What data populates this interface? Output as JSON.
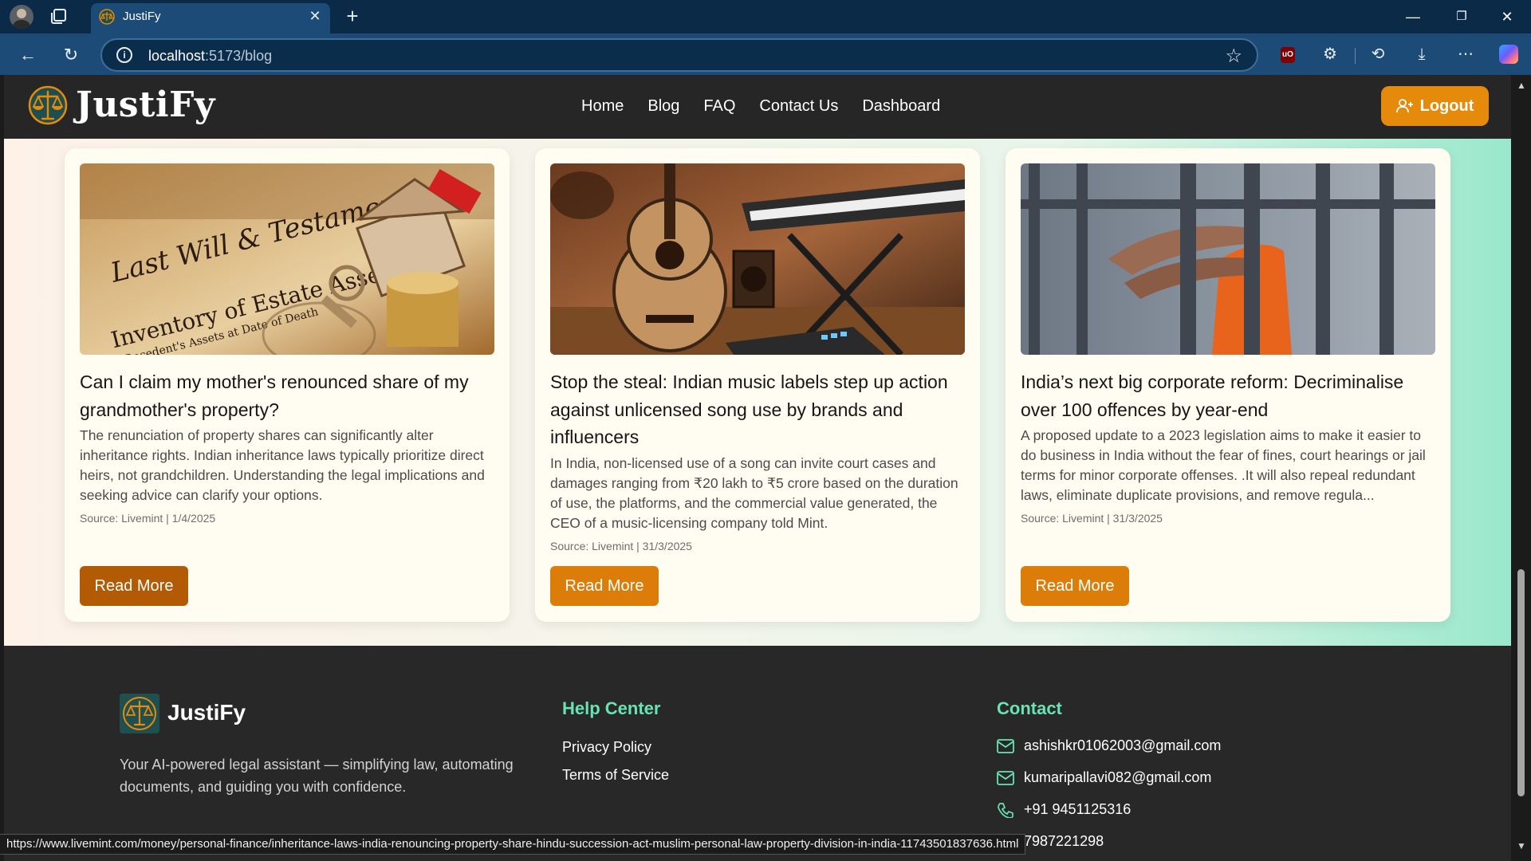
{
  "browser": {
    "tab_title": "JustiFy",
    "url_host": "localhost",
    "url_path": ":5173/blog",
    "status_url": "https://www.livemint.com/money/personal-finance/inheritance-laws-india-renouncing-property-share-hindu-succession-act-muslim-personal-law-property-division-in-india-11743501837636.html",
    "icons": [
      "profile-icon",
      "tabs-icon",
      "new-tab-icon",
      "minimize-icon",
      "restore-icon",
      "close-icon",
      "back-icon",
      "reload-icon",
      "info-icon",
      "favorite-star-icon",
      "ublock-icon",
      "extensions-icon",
      "history-icon",
      "download-icon",
      "more-icon",
      "copilot-icon"
    ]
  },
  "site": {
    "brand": "JustiFy",
    "nav": [
      "Home",
      "Blog",
      "FAQ",
      "Contact Us",
      "Dashboard"
    ],
    "logout_label": "Logout",
    "accent": "#e68a0c"
  },
  "posts": [
    {
      "title": "Can I claim my mother's renounced share of my grandmother's property?",
      "description": "The renunciation of property shares can significantly alter inheritance rights. Indian inheritance laws typically prioritize direct heirs, not grandchildren. Understanding the legal implications and seeking advice can clarify your options.",
      "meta": "Source: Livemint | 1/4/2025",
      "button": "Read More",
      "button_color": "#b35a05"
    },
    {
      "title": "Stop the steal: Indian music labels step up action against unlicensed song use by brands and influencers",
      "description": "In India, non-licensed use of a song can invite court cases and damages ranging from ₹20 lakh to ₹5 crore based on the duration of use, the platforms, and the commercial value generated, the CEO of a music-licensing company told Mint.",
      "meta": "Source: Livemint | 31/3/2025",
      "button": "Read More",
      "button_color": "#dc7d0a"
    },
    {
      "title": "India’s next big corporate reform: Decriminalise over 100 offences by year-end",
      "description": "A proposed update to a 2023 legislation aims to make it easier to do business in India without the fear of fines, court hearings or jail terms for minor corporate offenses. .It will also repeal redundant laws, eliminate duplicate provisions, and remove regula...",
      "meta": "Source: Livemint | 31/3/2025",
      "button": "Read More",
      "button_color": "#dc7d0a"
    }
  ],
  "footer": {
    "brand": "JustiFy",
    "tagline": "Your AI-powered legal assistant — simplifying law, automating documents, and guiding you with confidence.",
    "help_heading": "Help Center",
    "help_links": [
      "Privacy Policy",
      "Terms of Service"
    ],
    "contact_heading": "Contact",
    "contacts": [
      {
        "icon": "mail-icon",
        "text": "ashishkr01062003@gmail.com"
      },
      {
        "icon": "mail-icon",
        "text": "kumaripallavi082@gmail.com"
      },
      {
        "icon": "phone-icon",
        "text": "+91 9451125316"
      },
      {
        "icon": "phone-icon",
        "text": "7987221298"
      }
    ],
    "heading_color": "#67e3b5"
  }
}
